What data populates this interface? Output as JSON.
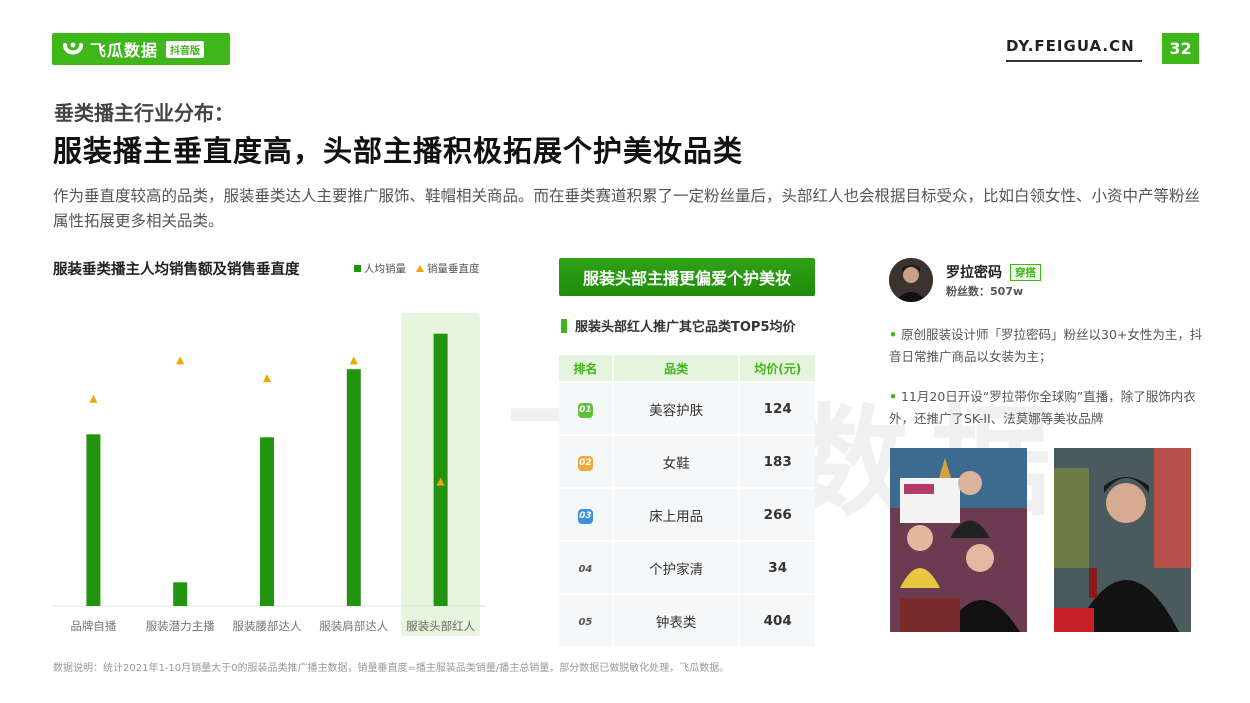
{
  "header": {
    "logo_text": "飞瓜数据",
    "logo_tag": "抖音版",
    "site": "DY.FEIGUA.CN",
    "page_number": "32",
    "watermark": "飞瓜数据"
  },
  "subtitle": "垂类播主行业分布：",
  "title": "服装播主垂直度高，头部主播积极拓展个护美妆品类",
  "description": "作为垂直度较高的品类，服装垂类达人主要推广服饰、鞋帽相关商品。而在垂类赛道积累了一定粉丝量后，头部红人也会根据目标受众，比如白领女性、小资中产等粉丝属性拓展更多相关品类。",
  "chart_data": {
    "type": "bar",
    "title": "服装垂类播主人均销售额及销售垂直度",
    "categories": [
      "品牌自播",
      "服装潜力主播",
      "服装腰部达人",
      "服装肩部达人",
      "服装头部红人"
    ],
    "series": [
      {
        "name": "人均销量",
        "type": "bar",
        "color": "#22940f",
        "values": [
          58,
          8,
          57,
          80,
          92
        ]
      },
      {
        "name": "销量垂直度",
        "type": "marker",
        "color": "#f0a500",
        "values": [
          70,
          83,
          77,
          83,
          42
        ]
      }
    ],
    "ylim": [
      0,
      100
    ],
    "highlight_category": "服装头部红人",
    "legend_position": "top-right"
  },
  "beauty": {
    "button": "服装头部主播更偏爱个护美妆",
    "table_title": "服装头部红人推广其它品类TOP5均价",
    "columns": [
      "排名",
      "品类",
      "均价(元)"
    ],
    "rows": [
      {
        "rank": "01",
        "category": "美容护肤",
        "price": "124",
        "badge_color": "#5cc23a"
      },
      {
        "rank": "02",
        "category": "女鞋",
        "price": "183",
        "badge_color": "#f0a93b"
      },
      {
        "rank": "03",
        "category": "床上用品",
        "price": "266",
        "badge_color": "#3d8fe0"
      },
      {
        "rank": "04",
        "category": "个护家清",
        "price": "34"
      },
      {
        "rank": "05",
        "category": "钟表类",
        "price": "404"
      }
    ]
  },
  "profile": {
    "name": "罗拉密码",
    "tag": "穿搭",
    "fans": "粉丝数：507w",
    "note1": "原创服装设计师「罗拉密码」粉丝以30+女性为主，抖音日常推广商品以女装为主；",
    "note2": "11月20日开设“罗拉带你全球购”直播，除了服饰内衣外，还推广了SK-II、法莫娜等美妆品牌"
  },
  "footnote": "数据说明：统计2021年1-10月销量大于0的服装品类推广播主数据，销量垂直度=播主服装品类销量/播主总销量，部分数据已做脱敏化处理，飞瓜数据。"
}
